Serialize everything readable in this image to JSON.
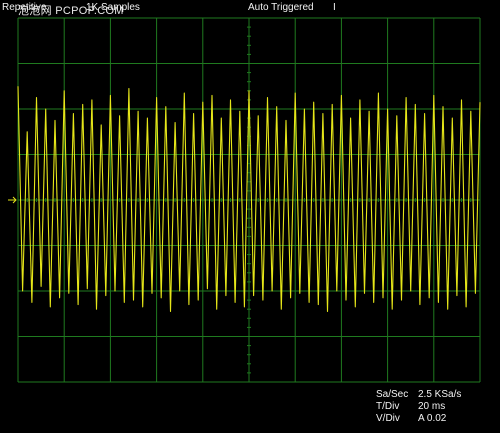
{
  "header": {
    "acq_mode": "Repetitive",
    "samples": "1K Samples",
    "trigger_status": "Auto Triggered",
    "trigger_marker": "I",
    "watermark": "泡泡网  PCPOP.COM"
  },
  "readouts": [
    {
      "label": "Sa/Sec",
      "value": "2.5 KSa/s"
    },
    {
      "label": "T/Div",
      "value": "20 ms"
    },
    {
      "label": "V/Div",
      "value": "A 0.02"
    }
  ],
  "screen": {
    "grid_color": "#1f7a1f",
    "trace_color": "#e6e619",
    "ground_marker_color": "#e6e619",
    "divisions_x": 10,
    "divisions_y": 8
  },
  "chart_data": {
    "type": "line",
    "title": "",
    "xlabel": "",
    "ylabel": "",
    "xlim": [
      0,
      200
    ],
    "ylim": [
      -0.08,
      0.08
    ],
    "x_unit": "ms",
    "y_unit": "V",
    "series": [
      {
        "x": [
          0,
          2,
          4,
          6,
          8,
          10,
          12,
          14,
          16,
          18,
          20,
          22,
          24,
          26,
          28,
          30,
          32,
          34,
          36,
          38,
          40,
          42,
          44,
          46,
          48,
          50,
          52,
          54,
          56,
          58,
          60,
          62,
          64,
          66,
          68,
          70,
          72,
          74,
          76,
          78,
          80,
          82,
          84,
          86,
          88,
          90,
          92,
          94,
          96,
          98,
          100,
          102,
          104,
          106,
          108,
          110,
          112,
          114,
          116,
          118,
          120,
          122,
          124,
          126,
          128,
          130,
          132,
          134,
          136,
          138,
          140,
          142,
          144,
          146,
          148,
          150,
          152,
          154,
          156,
          158,
          160,
          162,
          164,
          166,
          168,
          170,
          172,
          174,
          176,
          178,
          180,
          182,
          184,
          186,
          188,
          190,
          192,
          194,
          196,
          198,
          200
        ],
        "values": [
          0.05,
          -0.04,
          0.03,
          -0.045,
          0.045,
          -0.038,
          0.04,
          -0.047,
          0.035,
          -0.043,
          0.048,
          -0.041,
          0.038,
          -0.046,
          0.042,
          -0.039,
          0.044,
          -0.048,
          0.033,
          -0.042,
          0.046,
          -0.04,
          0.037,
          -0.045,
          0.049,
          -0.044,
          0.039,
          -0.047,
          0.036,
          -0.041,
          0.045,
          -0.043,
          0.041,
          -0.049,
          0.034,
          -0.04,
          0.047,
          -0.046,
          0.038,
          -0.044,
          0.043,
          -0.039,
          0.046,
          -0.048,
          0.036,
          -0.042,
          0.044,
          -0.045,
          0.039,
          -0.047,
          0.048,
          -0.042,
          0.037,
          -0.044,
          0.045,
          -0.04,
          0.041,
          -0.048,
          0.035,
          -0.043,
          0.047,
          -0.041,
          0.04,
          -0.045,
          0.043,
          -0.046,
          0.038,
          -0.049,
          0.042,
          -0.04,
          0.046,
          -0.044,
          0.036,
          -0.047,
          0.044,
          -0.041,
          0.039,
          -0.045,
          0.047,
          -0.043,
          0.04,
          -0.048,
          0.037,
          -0.044,
          0.045,
          -0.04,
          0.042,
          -0.046,
          0.038,
          -0.043,
          0.046,
          -0.045,
          0.041,
          -0.048,
          0.036,
          -0.042,
          0.044,
          -0.047,
          0.039,
          -0.041,
          0.043
        ]
      }
    ]
  }
}
